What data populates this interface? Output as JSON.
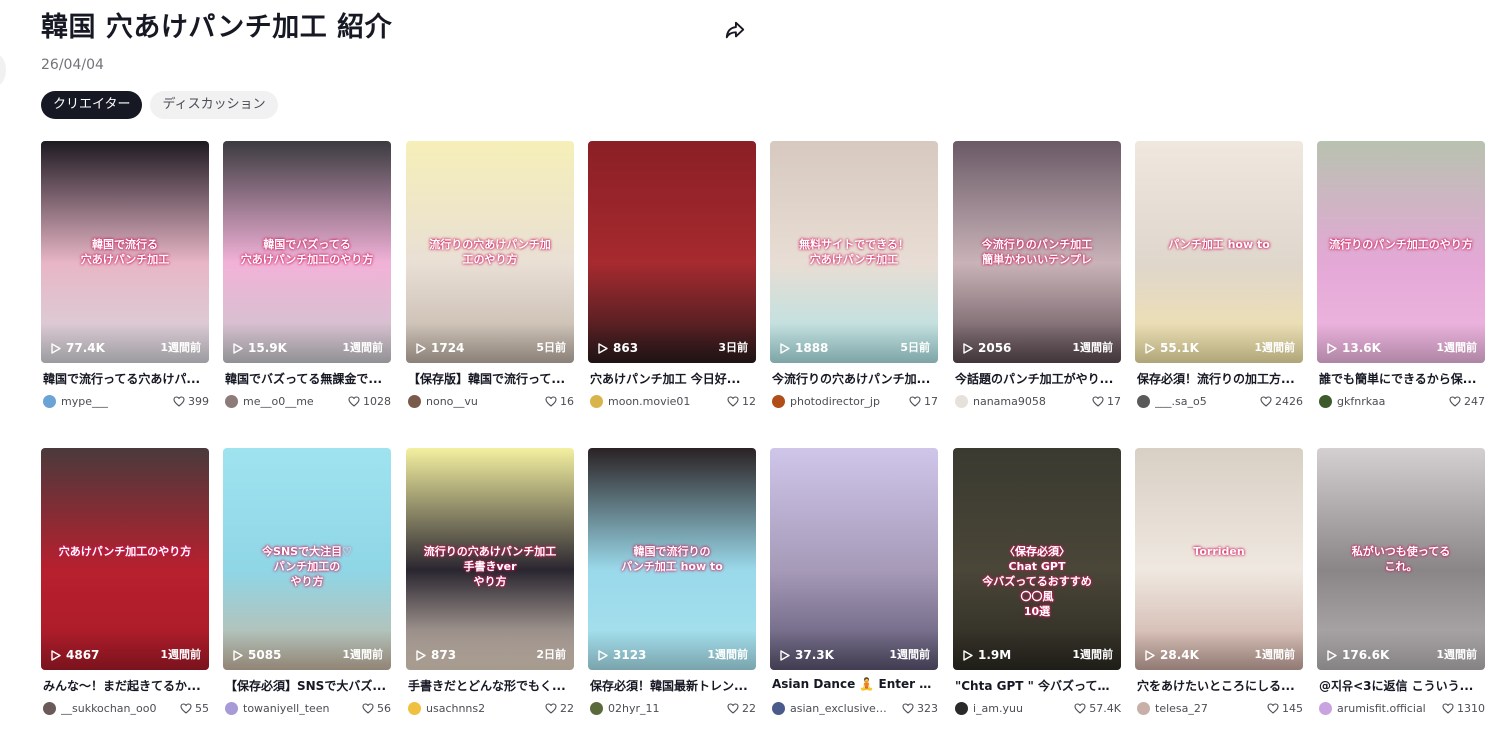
{
  "page": {
    "title": "韓国 穴あけパンチ加工 紹介",
    "date": "26/04/04",
    "tabs": [
      {
        "label": "クリエイター",
        "active": true
      },
      {
        "label": "ディスカッション",
        "active": false
      }
    ]
  },
  "icons": {
    "share": "share-icon",
    "play": "play-icon",
    "heart": "heart-icon"
  },
  "videos": [
    {
      "views": "77.4K",
      "age": "1週間前",
      "caption": "韓国で流行ってる穴あけパ...",
      "author": "mype___",
      "likes": "399",
      "overlay": "韓国で流行る\n穴あけパンチ加工",
      "bg": [
        "#1e1a22",
        "#e8b6c6",
        "#d6d6dc"
      ],
      "avatar_color": "#6ba3d6"
    },
    {
      "views": "15.9K",
      "age": "1週間前",
      "caption": "韓国でバズってる無課金で...",
      "author": "me__o0__me",
      "likes": "1028",
      "overlay": "韓国でバズってる\n穴あけパンチ加工のやり方",
      "bg": [
        "#3b3b40",
        "#f2b2d8",
        "#c8c8cc"
      ],
      "avatar_color": "#8c7b78"
    },
    {
      "views": "1724",
      "age": "5日前",
      "caption": "【保存版】韓国で流行って...",
      "author": "nono__vu",
      "likes": "16",
      "overlay": "流行りの穴あけパンチ加\n工のやり方",
      "bg": [
        "#f6efb8",
        "#e9dfd5",
        "#bfb2a6"
      ],
      "avatar_color": "#7a5a4a"
    },
    {
      "views": "863",
      "age": "3日前",
      "caption": "穴あけパンチ加工 今日好...",
      "author": "moon.movie01",
      "likes": "12",
      "overlay": "",
      "bg": [
        "#8a1f25",
        "#a62a2f",
        "#2a1a1c"
      ],
      "avatar_color": "#d9b44a"
    },
    {
      "views": "1888",
      "age": "5日前",
      "caption": "今流行りの穴あけパンチ加...",
      "author": "photodirector_jp",
      "likes": "17",
      "overlay": "無料サイトでできる！\n穴あけパンチ加工",
      "bg": [
        "#d7c9bf",
        "#e8ddd4",
        "#aee3e6"
      ],
      "avatar_color": "#b14d16"
    },
    {
      "views": "2056",
      "age": "1週間前",
      "caption": "今話題のパンチ加工がやり...",
      "author": "nanama9058",
      "likes": "17",
      "overlay": "今流行りのパンチ加工\n簡単かわいいテンプレ",
      "bg": [
        "#6a5a66",
        "#c9b3b8",
        "#5a4a50"
      ],
      "avatar_color": "#e6e1da"
    },
    {
      "views": "55.1K",
      "age": "1週間前",
      "caption": "保存必須！流行りの加工方...",
      "author": "___.sa_o5",
      "likes": "2426",
      "overlay": "パンチ加工 how to",
      "bg": [
        "#efe8df",
        "#dfd6cc",
        "#f3e4a8"
      ],
      "avatar_color": "#5a5a5a"
    },
    {
      "views": "13.6K",
      "age": "1週間前",
      "caption": "誰でも簡単にできるから保...",
      "author": "gkfnrkaa",
      "likes": "247",
      "overlay": "流行りのパンチ加工のやり方",
      "bg": [
        "#b8c2b0",
        "#e4a8d6",
        "#f0b8e2"
      ],
      "avatar_color": "#3d5a2a"
    },
    {
      "views": "4867",
      "age": "1週間前",
      "caption": "みんな〜！まだ起きてるか...",
      "author": "__sukkochan_oo0",
      "likes": "55",
      "overlay": "穴あけパンチ加工のやり方",
      "bg": [
        "#4a3a3c",
        "#b8202e",
        "#a81a28"
      ],
      "avatar_color": "#6a5a5a"
    },
    {
      "views": "5085",
      "age": "1週間前",
      "caption": "【保存必須】SNSで大バズ...",
      "author": "towaniyell_teen",
      "likes": "56",
      "overlay": "今SNSで大注目♡\nパンチ加工の\nやり方",
      "bg": [
        "#9fe3ef",
        "#8fd6e6",
        "#c8b7a2"
      ],
      "avatar_color": "#a79ad6"
    },
    {
      "views": "873",
      "age": "2日前",
      "caption": "手書きだとどんな形でもく...",
      "author": "usachnns2",
      "likes": "22",
      "overlay": "流行りの穴あけパンチ加工\n手書きver\nやり方",
      "bg": [
        "#f4f0a0",
        "#2a2630",
        "#e6d6c6"
      ],
      "avatar_color": "#f0c040"
    },
    {
      "views": "3123",
      "age": "1週間前",
      "caption": "保存必須！韓国最新トレン...",
      "author": "02hyr_11",
      "likes": "22",
      "overlay": "韓国で流行りの\nパンチ加工 how to",
      "bg": [
        "#2a2224",
        "#9ad9ea",
        "#a8e2ee"
      ],
      "avatar_color": "#5a6a3a"
    },
    {
      "views": "37.3K",
      "age": "1週間前",
      "caption": "Asian Dance 🧘 Enter a...",
      "author": "asian_exclusive_...",
      "likes": "323",
      "overlay": "",
      "bg": [
        "#cfc6ea",
        "#a69ab8",
        "#5a5470"
      ],
      "avatar_color": "#4a5a8a"
    },
    {
      "views": "1.9M",
      "age": "1週間前",
      "caption": "\"Chta GPT \" 今バズってる...",
      "author": "i_am.yuu",
      "likes": "57.4K",
      "overlay": "〈保存必須〉\nChat GPT\n今バズってるおすすめ\n〇〇風\n10選",
      "bg": [
        "#3a3a30",
        "#4a4638",
        "#2a2820"
      ],
      "avatar_color": "#2a2a2a"
    },
    {
      "views": "28.4K",
      "age": "1週間前",
      "caption": "穴をあけたいところにしる...",
      "author": "telesa_27",
      "likes": "145",
      "overlay": "Torriden",
      "bg": [
        "#d8d0c4",
        "#efe8e0",
        "#c9a9a0"
      ],
      "avatar_color": "#c8b0a8"
    },
    {
      "views": "176.6K",
      "age": "1週間前",
      "caption": "@지유<3に返信 こういう...",
      "author": "arumisfit.official",
      "likes": "1310",
      "overlay": "私がいつも使ってる\nこれ。",
      "bg": [
        "#d4d0d2",
        "#8a8688",
        "#b8b4b6"
      ],
      "avatar_color": "#c9a3e0"
    }
  ]
}
